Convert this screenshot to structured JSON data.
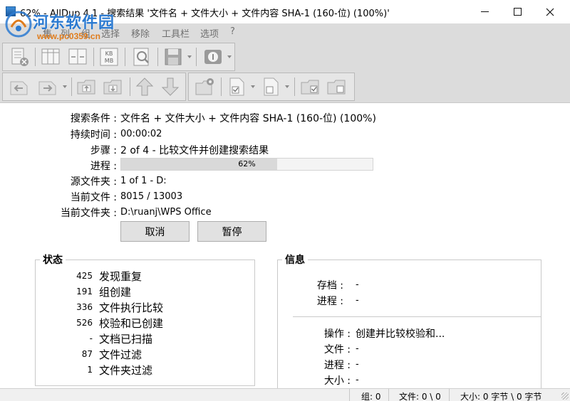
{
  "window": {
    "title": "62% - AllDup 4.1 - 搜索结果 '文件名 + 文件大小 + 文件内容 SHA-1 (160-位) (100%)'"
  },
  "watermark": {
    "title": "河东软件园",
    "url": "www.pc0359.cn"
  },
  "menu": [
    "集",
    "列",
    "组",
    "选择",
    "移除",
    "工具栏",
    "选项",
    "?"
  ],
  "toolbar_icons": {
    "row1": [
      "close-results-icon",
      "columns-icon",
      "column-width-icon",
      "file-size-units-icon",
      "preview-icon",
      "save-icon",
      "info-icon"
    ],
    "row2": [
      "undo-icon",
      "redo-icon",
      "folder-up-icon",
      "folder-down-icon",
      "move-up-icon",
      "move-down-icon",
      "folder-settings-icon",
      "check-file-icon",
      "uncheck-file-icon",
      "check-folder-icon",
      "uncheck-folder-icon"
    ]
  },
  "progress": {
    "criteria_label": "搜索条件 :",
    "criteria_value": "文件名 + 文件大小 + 文件内容 SHA-1 (160-位) (100%)",
    "duration_label": "持续时间 :",
    "duration_value": "00:00:02",
    "step_label": "步骤 :",
    "step_value": "2 of 4 - 比较文件并创建搜索结果",
    "progress_label": "进程 :",
    "progress_percent": 62,
    "progress_text": "62%",
    "source_label": "源文件夹 :",
    "source_value": "1 of 1 - D:",
    "current_file_label": "当前文件 :",
    "current_file_value": "8015 / 13003",
    "current_folder_label": "当前文件夹 :",
    "current_folder_value": "D:\\ruanj\\WPS Office",
    "cancel_label": "取消",
    "pause_label": "暂停"
  },
  "status_group": {
    "title": "状态",
    "rows": [
      {
        "num": "425",
        "text": "发现重复"
      },
      {
        "num": "191",
        "text": "组创建"
      },
      {
        "num": "336",
        "text": "文件执行比较"
      },
      {
        "num": "526",
        "text": "校验和已创建"
      },
      {
        "num": "-",
        "text": "文档已扫描"
      },
      {
        "num": "87",
        "text": "文件过滤"
      },
      {
        "num": "1",
        "text": "文件夹过滤"
      }
    ]
  },
  "info_group": {
    "title": "信息",
    "archive_label": "存档 :",
    "archive_value": "-",
    "progress_label": "进程 :",
    "progress_value": "-",
    "operation_label": "操作 :",
    "operation_value": "创建并比较校验和...",
    "file_label": "文件 :",
    "file_value": "-",
    "progress2_label": "进程 :",
    "progress2_value": "-",
    "size_label": "大小 :",
    "size_value": "-"
  },
  "statusbar": {
    "groups": "组: 0",
    "files": "文件: 0 \\ 0",
    "size": "大小: 0 字节 \\ 0 字节"
  }
}
